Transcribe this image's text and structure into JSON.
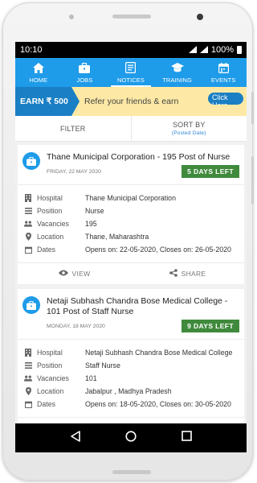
{
  "status": {
    "time": "10:10",
    "battery": "100%"
  },
  "tabs": [
    {
      "label": "HOME",
      "icon": "home-icon"
    },
    {
      "label": "JOBS",
      "icon": "briefcase-icon"
    },
    {
      "label": "NOTICES",
      "icon": "notice-icon"
    },
    {
      "label": "TRAINING",
      "icon": "graduation-cap-icon"
    },
    {
      "label": "EVENTS",
      "icon": "calendar-icon"
    }
  ],
  "active_tab": "NOTICES",
  "refer": {
    "earn": "EARN ₹ 500",
    "text": "Refer your friends & earn",
    "button": "Click Here"
  },
  "filter": {
    "filter_label": "FILTER",
    "sort_label": "SORT BY",
    "sort_sub": "(Posted Date)"
  },
  "field_labels": {
    "hospital": "Hospital",
    "position": "Position",
    "vacancies": "Vacancies",
    "location": "Location",
    "dates": "Dates"
  },
  "actions": {
    "view": "VIEW",
    "share": "SHARE"
  },
  "jobs": [
    {
      "title": "Thane Municipal Corporation - 195 Post of Nurse",
      "date": "FRIDAY, 22 MAY 2020",
      "days_left": "5 DAYS LEFT",
      "hospital": "Thane Municipal Corporation",
      "position": "Nurse",
      "vacancies": "195",
      "location": "Thane, Maharashtra",
      "dates": "Opens on: 22-05-2020, Closes on: 26-05-2020"
    },
    {
      "title": "Netaji Subhash Chandra Bose Medical College - 101 Post of Staff Nurse",
      "date": "MONDAY, 18 MAY 2020",
      "days_left": "9 DAYS LEFT",
      "hospital": "Netaji Subhash Chandra Bose Medical College",
      "position": "Staff Nurse",
      "vacancies": "101",
      "location": "Jabalpur , Madhya Pradesh",
      "dates": "Opens on: 18-05-2020, Closes on: 30-05-2020"
    }
  ],
  "colors": {
    "primary": "#1e9be9",
    "earn": "#1a7fc4",
    "refer_bg": "#fde9a5",
    "badge": "#3f8a3c"
  }
}
